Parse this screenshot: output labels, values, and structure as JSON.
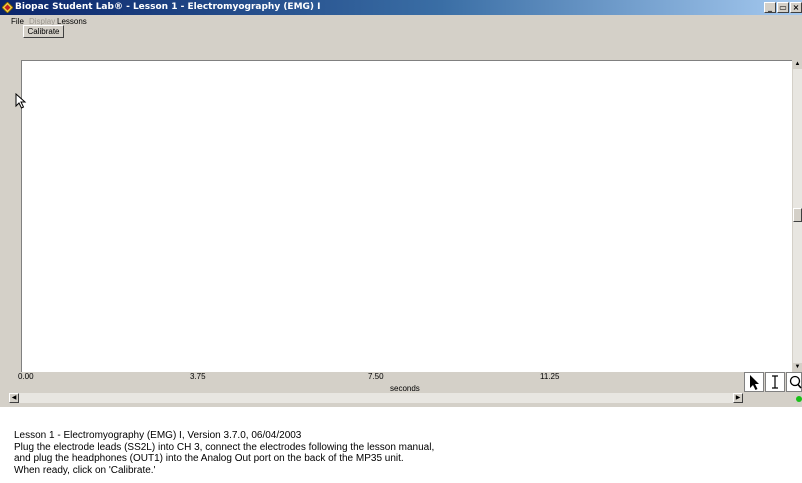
{
  "window": {
    "title": "Biopac Student Lab® - Lesson 1 - Electromyography (EMG) I",
    "minimize_label": "_",
    "maximize_label": "▭",
    "close_label": "×"
  },
  "menu": {
    "items": [
      {
        "label": "File",
        "enabled": true
      },
      {
        "label": "Display",
        "enabled": false
      },
      {
        "label": "Lessons",
        "enabled": true
      }
    ]
  },
  "toolbar": {
    "calibrate_label": "Calibrate"
  },
  "graph": {
    "x_ticks": [
      "0.00",
      "3.75",
      "7.50",
      "11.25"
    ],
    "x_unit": "seconds"
  },
  "tools": [
    "arrow-tool",
    "ibeam-tool",
    "zoom-tool"
  ],
  "journal": {
    "lines": [
      "Lesson 1 - Electromyography (EMG) I, Version 3.7.0, 06/04/2003",
      "Plug the electrode leads (SS2L) into CH 3, connect the electrodes following the lesson manual,",
      "and plug the headphones (OUT1) into the Analog Out port on the back of the MP35 unit.",
      "When ready, click on 'Calibrate.'"
    ]
  },
  "colors": {
    "title_start": "#0a246a",
    "title_end": "#a6caf0",
    "face": "#d4d0c8",
    "status": "#19c019"
  }
}
